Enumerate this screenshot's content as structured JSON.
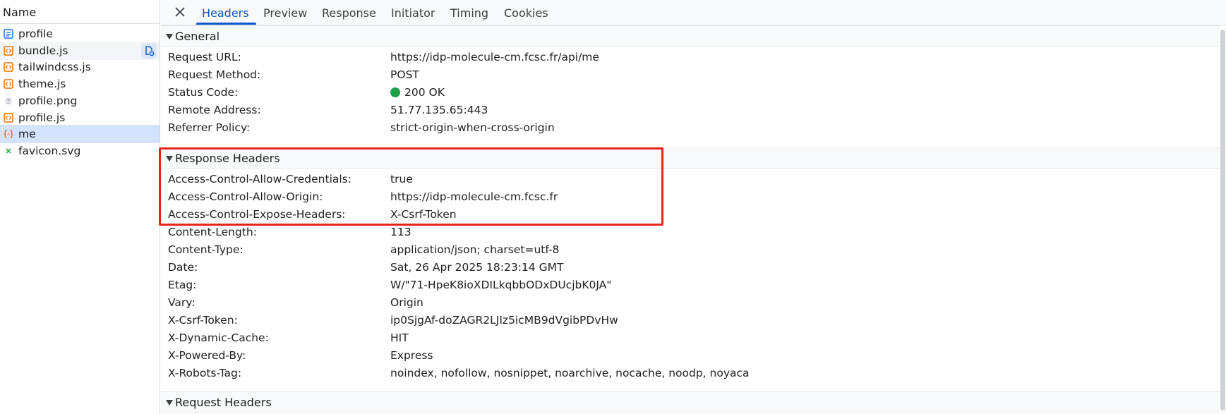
{
  "left": {
    "header": "Name",
    "files": [
      {
        "name": "profile",
        "icon": "document-icon",
        "color": "#1a73e8"
      },
      {
        "name": "bundle.js",
        "icon": "script-icon",
        "color": "#e8710a"
      },
      {
        "name": "tailwindcss.js",
        "icon": "script-icon",
        "color": "#e8710a"
      },
      {
        "name": "theme.js",
        "icon": "script-icon",
        "color": "#e8710a"
      },
      {
        "name": "profile.png",
        "icon": "image-icon",
        "color": "#bdc1c6"
      },
      {
        "name": "profile.js",
        "icon": "script-icon",
        "color": "#e8710a"
      },
      {
        "name": "me",
        "icon": "json-icon",
        "color": "#e8710a"
      },
      {
        "name": "favicon.svg",
        "icon": "svg-icon",
        "color": "#34a853"
      }
    ]
  },
  "tabs": [
    "Headers",
    "Preview",
    "Response",
    "Initiator",
    "Timing",
    "Cookies"
  ],
  "general": {
    "title": "General",
    "rows": [
      {
        "name": "Request URL:",
        "value": "https://idp-molecule-cm.fcsc.fr/api/me"
      },
      {
        "name": "Request Method:",
        "value": "POST"
      },
      {
        "name": "Status Code:",
        "value": "200 OK"
      },
      {
        "name": "Remote Address:",
        "value": "51.77.135.65:443"
      },
      {
        "name": "Referrer Policy:",
        "value": "strict-origin-when-cross-origin"
      }
    ]
  },
  "response_headers": {
    "title": "Response Headers",
    "rows": [
      {
        "name": "Access-Control-Allow-Credentials:",
        "value": "true"
      },
      {
        "name": "Access-Control-Allow-Origin:",
        "value": "https://idp-molecule-cm.fcsc.fr"
      },
      {
        "name": "Access-Control-Expose-Headers:",
        "value": "X-Csrf-Token"
      },
      {
        "name": "Content-Length:",
        "value": "113"
      },
      {
        "name": "Content-Type:",
        "value": "application/json; charset=utf-8"
      },
      {
        "name": "Date:",
        "value": "Sat, 26 Apr 2025 18:23:14 GMT"
      },
      {
        "name": "Etag:",
        "value": "W/\"71-HpeK8ioXDILkqbbODxDUcjbK0JA\""
      },
      {
        "name": "Vary:",
        "value": "Origin"
      },
      {
        "name": "X-Csrf-Token:",
        "value": "ip0SjgAf-doZAGR2LJIz5icMB9dVgibPDvHw"
      },
      {
        "name": "X-Dynamic-Cache:",
        "value": "HIT"
      },
      {
        "name": "X-Powered-By:",
        "value": "Express"
      },
      {
        "name": "X-Robots-Tag:",
        "value": "noindex, nofollow, nosnippet, noarchive, nocache, noodp, noyaca"
      }
    ]
  },
  "request_headers": {
    "title": "Request Headers"
  },
  "colors": {
    "accent": "#0b57d0",
    "highlight_border": "#e8231e",
    "status_ok": "#1e9e49",
    "selected_row": "#d3e3fd"
  }
}
